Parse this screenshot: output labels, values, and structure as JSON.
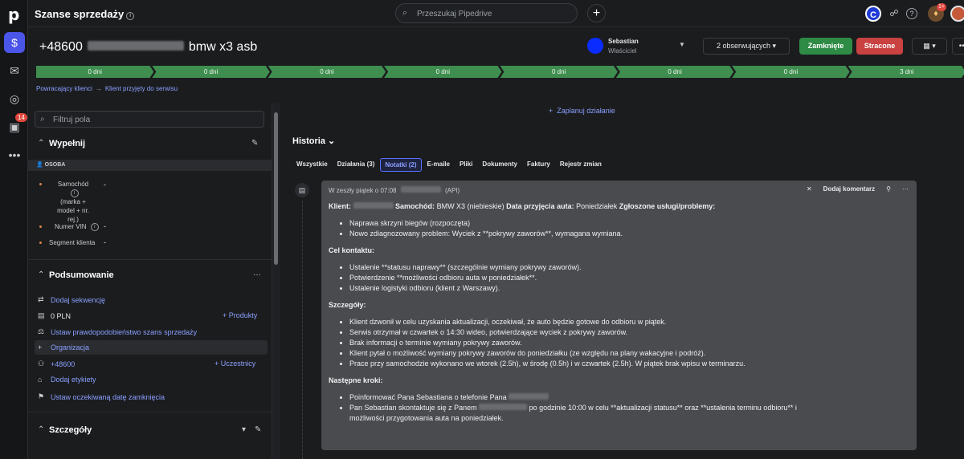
{
  "topbar": {
    "title": "Szanse sprzedaży",
    "search_placeholder": "Przeszukaj Pipedrive",
    "plus": "+",
    "user_initial": "C",
    "help": "?",
    "notif_badge": "1+",
    "icons": {
      "info": "info-icon",
      "search": "search-icon",
      "help": "help-icon",
      "bulb": "lightbulb-icon"
    }
  },
  "leftnav": {
    "logo": "p",
    "badge": "14",
    "items": [
      "deals-icon",
      "mail-icon",
      "location-icon",
      "calendar-icon",
      "more-icon"
    ]
  },
  "deal": {
    "title_prefix": "+48600",
    "title_suffix": "bmw x3 asb",
    "owner_name": "Sebastian",
    "owner_role": "Właściciel",
    "followers": "2 obserwujących",
    "won": "Zamknięte",
    "lost": "Stracone"
  },
  "colors": {
    "accent": "#4b55e8",
    "won": "#2e8b45",
    "lost": "#c94141",
    "stage": "#3f8e4f",
    "link": "#8aa0ff"
  },
  "pipeline": [
    "0 dni",
    "0 dni",
    "0 dni",
    "0 dni",
    "0 dni",
    "0 dni",
    "0 dni",
    "3 dni"
  ],
  "breadcrumb": [
    "Powracający klienci",
    "Klient przyjęty do serwisu"
  ],
  "sidebar": {
    "filter_placeholder": "Filtruj pola",
    "fill_title": "Wypełnij",
    "person_label": "OSOBA",
    "fields": [
      {
        "label1": "Samochód",
        "label2": "(marka +",
        "label3": "model + nr.",
        "label4": "rej.)",
        "value": "-"
      },
      {
        "label1": "Numer VIN",
        "value": "-"
      },
      {
        "label1": "Segment klienta",
        "value": "-"
      }
    ],
    "summary_title": "Podsumowanie",
    "summary": {
      "add_sequence": "Dodaj sekwencję",
      "amount": "0 PLN",
      "products": "Produkty",
      "probability": "Ustaw prawdopodobieństwo szans sprzedaży",
      "organization": "Organizacja",
      "person": "+48600",
      "participants": "Uczestnicy",
      "labels": "Dodaj etykiety",
      "close_date": "Ustaw oczekiwaną datę zamknięcia"
    },
    "details_title": "Szczegóły"
  },
  "main": {
    "plan_activity": "Zaplanuj działanie",
    "history_title": "Historia",
    "tabs": [
      "Wszystkie",
      "Działania (3)",
      "Notatki (2)",
      "E-maile",
      "Pliki",
      "Dokumenty",
      "Faktury",
      "Rejestr zmian"
    ],
    "active_tab": "Notatki (2)"
  },
  "note": {
    "meta": "W zeszły piątek o 07:08",
    "meta_suffix": "(API)",
    "add_comment": "Dodaj komentarz",
    "client_label": "Klient:",
    "car_label": "Samochód:",
    "car_value": "BMW X3 (niebieskie)",
    "date_label": "Data przyjęcia auta:",
    "date_value": "Poniedziałek",
    "services_label": "Zgłoszone usługi/problemy:",
    "services": [
      "Naprawa skrzyni biegów (rozpoczęta)",
      "Nowo zdiagnozowany problem: Wyciek z **pokrywy zaworów**, wymagana wymiana."
    ],
    "goal_label": "Cel kontaktu:",
    "goals": [
      "Ustalenie **statusu naprawy** (szczególnie wymiany pokrywy zaworów).",
      "Potwierdzenie **możliwości odbioru auta w poniedziałek**.",
      "Ustalenie logistyki odbioru (klient z Warszawy)."
    ],
    "details_label": "Szczegóły:",
    "details": [
      "Klient dzwonił w celu uzyskania aktualizacji, oczekiwał, że auto będzie gotowe do odbioru w piątek.",
      "Serwis otrzymał w czwartek o 14:30 wideo, potwierdzające wyciek z pokrywy zaworów.",
      "Brak informacji o terminie wymiany pokrywy zaworów.",
      "Klient pytał o możliwość wymiany pokrywy zaworów do poniedziałku (ze względu na plany wakacyjne i podróż).",
      "Prace przy samochodzie wykonano we wtorek (2.5h), w środę (0.5h) i w czwartek (2.5h). W piątek brak wpisu w terminarzu."
    ],
    "next_label": "Następne kroki:",
    "next1": "Poinformować Pana Sebastiana o telefonie Pana",
    "next2a": "Pan Sebastian skontaktuje się z Panem",
    "next2b": "po godzinie 10:00 w celu **aktualizacji statusu** oraz **ustalenia terminu odbioru** i",
    "next2c": "możliwości przygotowania auta na poniedziałek."
  }
}
